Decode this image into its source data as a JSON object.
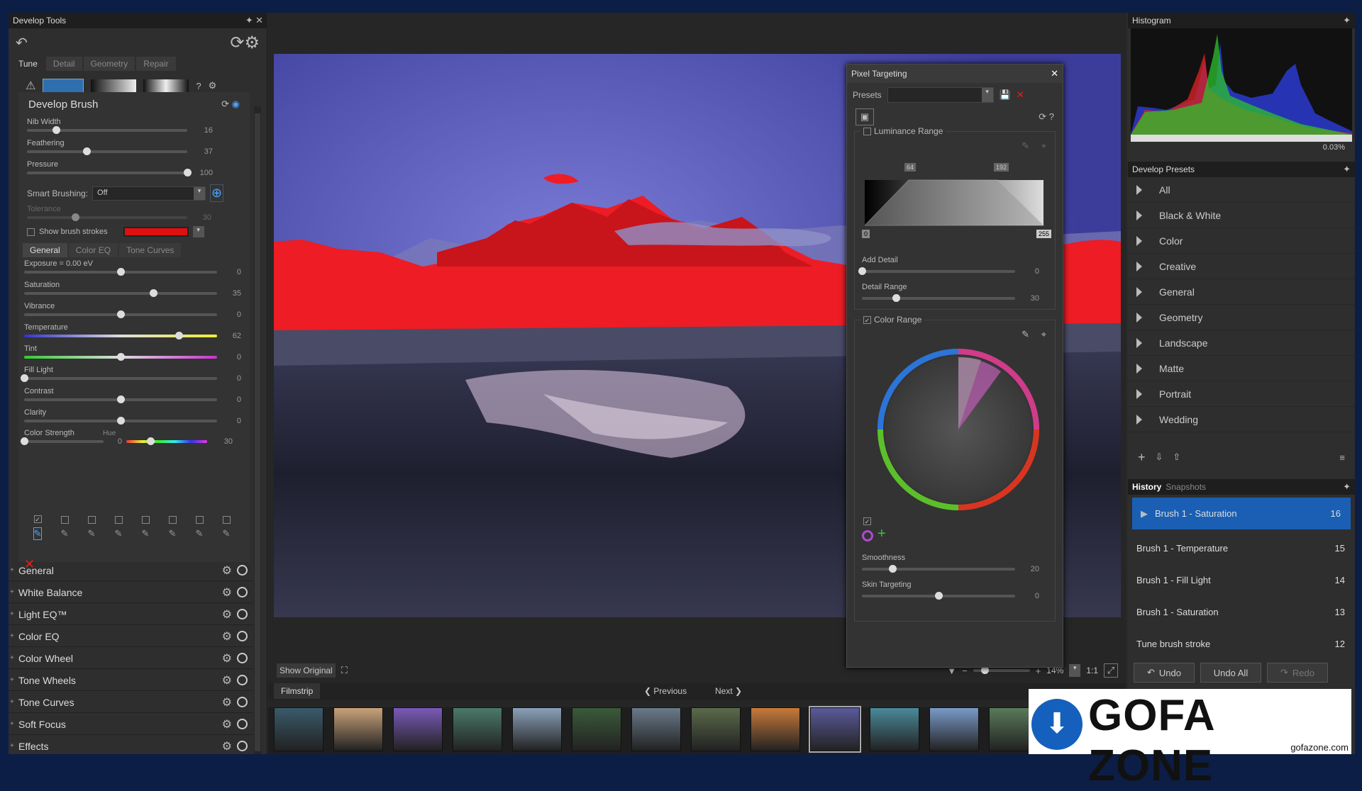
{
  "left": {
    "title": "Develop Tools",
    "tabs": [
      "Tune",
      "Detail",
      "Geometry",
      "Repair"
    ],
    "brush": {
      "title": "Develop Brush",
      "sliders": [
        {
          "label": "Nib Width",
          "value": "16",
          "pos": 0.18
        },
        {
          "label": "Feathering",
          "value": "37",
          "pos": 0.37
        },
        {
          "label": "Pressure",
          "value": "100",
          "pos": 1.0
        }
      ],
      "smart_label": "Smart Brushing:",
      "smart_value": "Off",
      "tolerance_label": "Tolerance",
      "tolerance_value": "30",
      "show_strokes": "Show brush strokes"
    },
    "subtabs": [
      "General",
      "Color EQ",
      "Tone Curves"
    ],
    "adjust": [
      {
        "label": "Exposure = 0.00 eV",
        "value": "0",
        "pos": 0.5
      },
      {
        "label": "Saturation",
        "value": "35",
        "pos": 0.67
      },
      {
        "label": "Vibrance",
        "value": "0",
        "pos": 0.5
      },
      {
        "label": "Temperature",
        "value": "62",
        "pos": 0.8
      },
      {
        "label": "Tint",
        "value": "0",
        "pos": 0.5
      },
      {
        "label": "Fill Light",
        "value": "0",
        "pos": 0.0
      },
      {
        "label": "Contrast",
        "value": "0",
        "pos": 0.5
      },
      {
        "label": "Clarity",
        "value": "0",
        "pos": 0.5
      }
    ],
    "color_strength": {
      "label": "Color Strength",
      "value": "0",
      "hue_label": "Hue",
      "hue_value": "30"
    },
    "sections": [
      "General",
      "White Balance",
      "Light EQ™",
      "Color EQ",
      "Color Wheel",
      "Tone Wheels",
      "Tone Curves",
      "Soft Focus",
      "Effects"
    ]
  },
  "center": {
    "show_original": "Show Original",
    "zoom": "14%",
    "ratio": "1:1",
    "filmstrip": "Filmstrip",
    "previous": "Previous",
    "next": "Next"
  },
  "pixel_targeting": {
    "title": "Pixel Targeting",
    "presets_label": "Presets",
    "luminance": {
      "label": "Luminance Range",
      "markers": [
        "64",
        "192",
        "0",
        "255"
      ],
      "add_detail": "Add Detail",
      "add_detail_value": "0",
      "detail_range": "Detail Range",
      "detail_range_value": "30"
    },
    "color": {
      "label": "Color Range",
      "smoothness": "Smoothness",
      "smoothness_value": "20",
      "skin": "Skin Targeting",
      "skin_value": "0"
    }
  },
  "right": {
    "histogram": {
      "title": "Histogram",
      "readout": "0.03%"
    },
    "presets": {
      "title": "Develop Presets",
      "items": [
        "All",
        "Black & White",
        "Color",
        "Creative",
        "General",
        "Geometry",
        "Landscape",
        "Matte",
        "Portrait",
        "Wedding"
      ]
    },
    "history": {
      "tabs": [
        "History",
        "Snapshots"
      ],
      "items": [
        {
          "label": "Brush 1 - Saturation",
          "n": "16"
        },
        {
          "label": "Brush 1 - Temperature",
          "n": "15"
        },
        {
          "label": "Brush 1 - Fill Light",
          "n": "14"
        },
        {
          "label": "Brush 1 - Saturation",
          "n": "13"
        },
        {
          "label": "Tune brush stroke",
          "n": "12"
        }
      ],
      "undo": "Undo",
      "undo_all": "Undo All",
      "redo": "Redo"
    }
  },
  "watermark": {
    "brand": "GOFA ZONE",
    "url": "gofazone.com"
  }
}
